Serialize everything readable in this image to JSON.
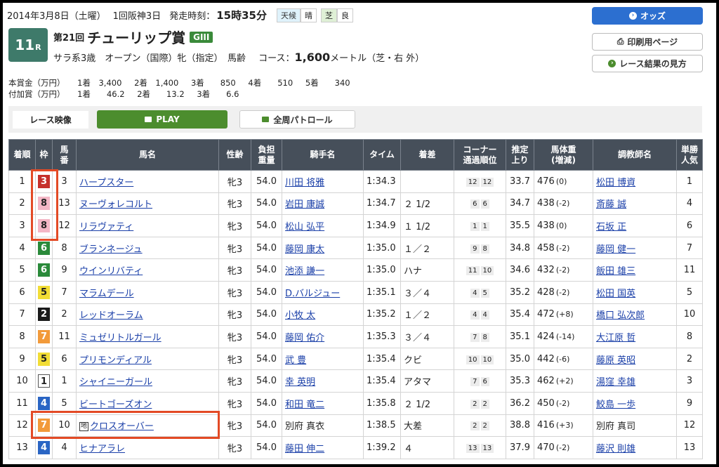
{
  "header": {
    "date": "2014年3月8日（土曜）",
    "meeting": "1回阪神3日",
    "start_label": "発走時刻：",
    "start_time": "15時35分",
    "weather_label": "天候",
    "weather": "晴",
    "track_label": "芝",
    "track_cond": "良",
    "race_no": "11",
    "race_no_suffix": "R",
    "edition": "第21回",
    "race_name": "チューリップ賞",
    "grade": "GIII",
    "conditions": "サラ系3歳　オープン（国際）牝（指定）　馬齢",
    "course_label": "コース：",
    "distance": "1,600",
    "course_detail": "メートル（芝・右 外）"
  },
  "buttons": {
    "odds": "オッズ",
    "print": "印刷用ページ",
    "guide": "レース結果の見方"
  },
  "prize": {
    "main_label": "本賞金（万円）",
    "main": [
      "1着　3,400",
      "2着　1,400",
      "3着　　850",
      "4着　　510",
      "5着　　340"
    ],
    "add_label": "付加賞（万円）",
    "add": [
      "1着　　46.2",
      "2着　　13.2",
      "3着　　6.6"
    ]
  },
  "video": {
    "label": "レース映像",
    "play": "PLAY",
    "patrol": "全周パトロール"
  },
  "columns": [
    "着順",
    "枠",
    "馬番",
    "馬名",
    "性齢",
    "負担重量",
    "騎手名",
    "タイム",
    "着差",
    "コーナー通過順位",
    "推定上り",
    "馬体重(増減)",
    "調教師名",
    "単勝人気"
  ],
  "columns_display": [
    "着順",
    "枠",
    "馬\n番",
    "馬名",
    "性齢",
    "負担\n重量",
    "騎手名",
    "タイム",
    "着差",
    "コーナー\n通過順位",
    "推定\n上り",
    "馬体重\n(増減)",
    "調教師名",
    "単勝\n人気"
  ],
  "waku_colors": {
    "1": "#ffffff",
    "2": "#1a1a1a",
    "3": "#c6302b",
    "4": "#2a65c4",
    "5": "#f2dd35",
    "6": "#2a8a3a",
    "7": "#f29a3a",
    "8": "#f4b7c6"
  },
  "rows": [
    {
      "pos": "1",
      "waku": "3",
      "num": "3",
      "horse": "ハープスター",
      "local": false,
      "sex_age": "牝3",
      "weight": "54.0",
      "jockey": "川田 将雅",
      "time": "1:34.3",
      "margin": "",
      "c1": "12",
      "c2": "12",
      "last": "33.7",
      "body": "476",
      "diff": "(0)",
      "trainer": "松田 博資",
      "pop": "1"
    },
    {
      "pos": "2",
      "waku": "8",
      "num": "13",
      "horse": "ヌーヴォレコルト",
      "local": false,
      "sex_age": "牝3",
      "weight": "54.0",
      "jockey": "岩田 康誠",
      "time": "1:34.7",
      "margin": "２ 1/2",
      "c1": "6",
      "c2": "6",
      "last": "34.7",
      "body": "438",
      "diff": "(-2)",
      "trainer": "斎藤 誠",
      "pop": "4"
    },
    {
      "pos": "3",
      "waku": "8",
      "num": "12",
      "horse": "リラヴァティ",
      "local": false,
      "sex_age": "牝3",
      "weight": "54.0",
      "jockey": "松山 弘平",
      "time": "1:34.9",
      "margin": "１ 1/2",
      "c1": "1",
      "c2": "1",
      "last": "35.5",
      "body": "438",
      "diff": "(0)",
      "trainer": "石坂 正",
      "pop": "6"
    },
    {
      "pos": "4",
      "waku": "6",
      "num": "8",
      "horse": "ブランネージュ",
      "local": false,
      "sex_age": "牝3",
      "weight": "54.0",
      "jockey": "藤岡 康太",
      "time": "1:35.0",
      "margin": "１／２",
      "c1": "9",
      "c2": "8",
      "last": "34.8",
      "body": "458",
      "diff": "(-2)",
      "trainer": "藤岡 健一",
      "pop": "7"
    },
    {
      "pos": "5",
      "waku": "6",
      "num": "9",
      "horse": "ウインリバティ",
      "local": false,
      "sex_age": "牝3",
      "weight": "54.0",
      "jockey": "池添 謙一",
      "time": "1:35.0",
      "margin": "ハナ",
      "c1": "11",
      "c2": "10",
      "last": "34.6",
      "body": "432",
      "diff": "(-2)",
      "trainer": "飯田 雄三",
      "pop": "11"
    },
    {
      "pos": "6",
      "waku": "5",
      "num": "7",
      "horse": "マラムデール",
      "local": false,
      "sex_age": "牝3",
      "weight": "54.0",
      "jockey": "D.バルジュー",
      "time": "1:35.1",
      "margin": "３／４",
      "c1": "4",
      "c2": "5",
      "last": "35.2",
      "body": "428",
      "diff": "(-2)",
      "trainer": "松田 国英",
      "pop": "5"
    },
    {
      "pos": "7",
      "waku": "2",
      "num": "2",
      "horse": "レッドオーラム",
      "local": false,
      "sex_age": "牝3",
      "weight": "54.0",
      "jockey": "小牧 太",
      "time": "1:35.2",
      "margin": "１／２",
      "c1": "4",
      "c2": "4",
      "last": "35.4",
      "body": "472",
      "diff": "(+8)",
      "trainer": "橋口 弘次郎",
      "pop": "10"
    },
    {
      "pos": "8",
      "waku": "7",
      "num": "11",
      "horse": "ミュゼリトルガール",
      "local": false,
      "sex_age": "牝3",
      "weight": "54.0",
      "jockey": "藤岡 佑介",
      "time": "1:35.3",
      "margin": "３／４",
      "c1": "7",
      "c2": "8",
      "last": "35.1",
      "body": "424",
      "diff": "(-14)",
      "trainer": "大江原 哲",
      "pop": "8"
    },
    {
      "pos": "9",
      "waku": "5",
      "num": "6",
      "horse": "プリモンディアル",
      "local": false,
      "sex_age": "牝3",
      "weight": "54.0",
      "jockey": "武 豊",
      "time": "1:35.4",
      "margin": "クビ",
      "c1": "10",
      "c2": "10",
      "last": "35.0",
      "body": "442",
      "diff": "(-6)",
      "trainer": "藤原 英昭",
      "pop": "2"
    },
    {
      "pos": "10",
      "waku": "1",
      "num": "1",
      "horse": "シャイニーガール",
      "local": false,
      "sex_age": "牝3",
      "weight": "54.0",
      "jockey": "幸 英明",
      "time": "1:35.4",
      "margin": "アタマ",
      "c1": "7",
      "c2": "6",
      "last": "35.3",
      "body": "462",
      "diff": "(+2)",
      "trainer": "湯窪 幸雄",
      "pop": "3"
    },
    {
      "pos": "11",
      "waku": "4",
      "num": "5",
      "horse": "ビートゴーズオン",
      "local": false,
      "sex_age": "牝3",
      "weight": "54.0",
      "jockey": "和田 竜二",
      "time": "1:35.8",
      "margin": "２ 1/2",
      "c1": "2",
      "c2": "2",
      "last": "36.2",
      "body": "450",
      "diff": "(-2)",
      "trainer": "鮫島 一歩",
      "pop": "9"
    },
    {
      "pos": "12",
      "waku": "7",
      "num": "10",
      "horse": "クロスオーバー",
      "local": true,
      "sex_age": "牝3",
      "weight": "54.0",
      "jockey": "別府 真衣",
      "time": "1:38.5",
      "margin": "大差",
      "c1": "2",
      "c2": "2",
      "last": "38.8",
      "body": "416",
      "diff": "(+3)",
      "trainer": "別府 真司",
      "pop": "12"
    },
    {
      "pos": "13",
      "waku": "4",
      "num": "4",
      "horse": "ヒナアラレ",
      "local": false,
      "sex_age": "牝3",
      "weight": "54.0",
      "jockey": "藤田 伸二",
      "time": "1:39.2",
      "margin": "４",
      "c1": "13",
      "c2": "13",
      "last": "37.9",
      "body": "470",
      "diff": "(-2)",
      "trainer": "藤沢 則雄",
      "pop": "13"
    }
  ],
  "local_mark": "地"
}
